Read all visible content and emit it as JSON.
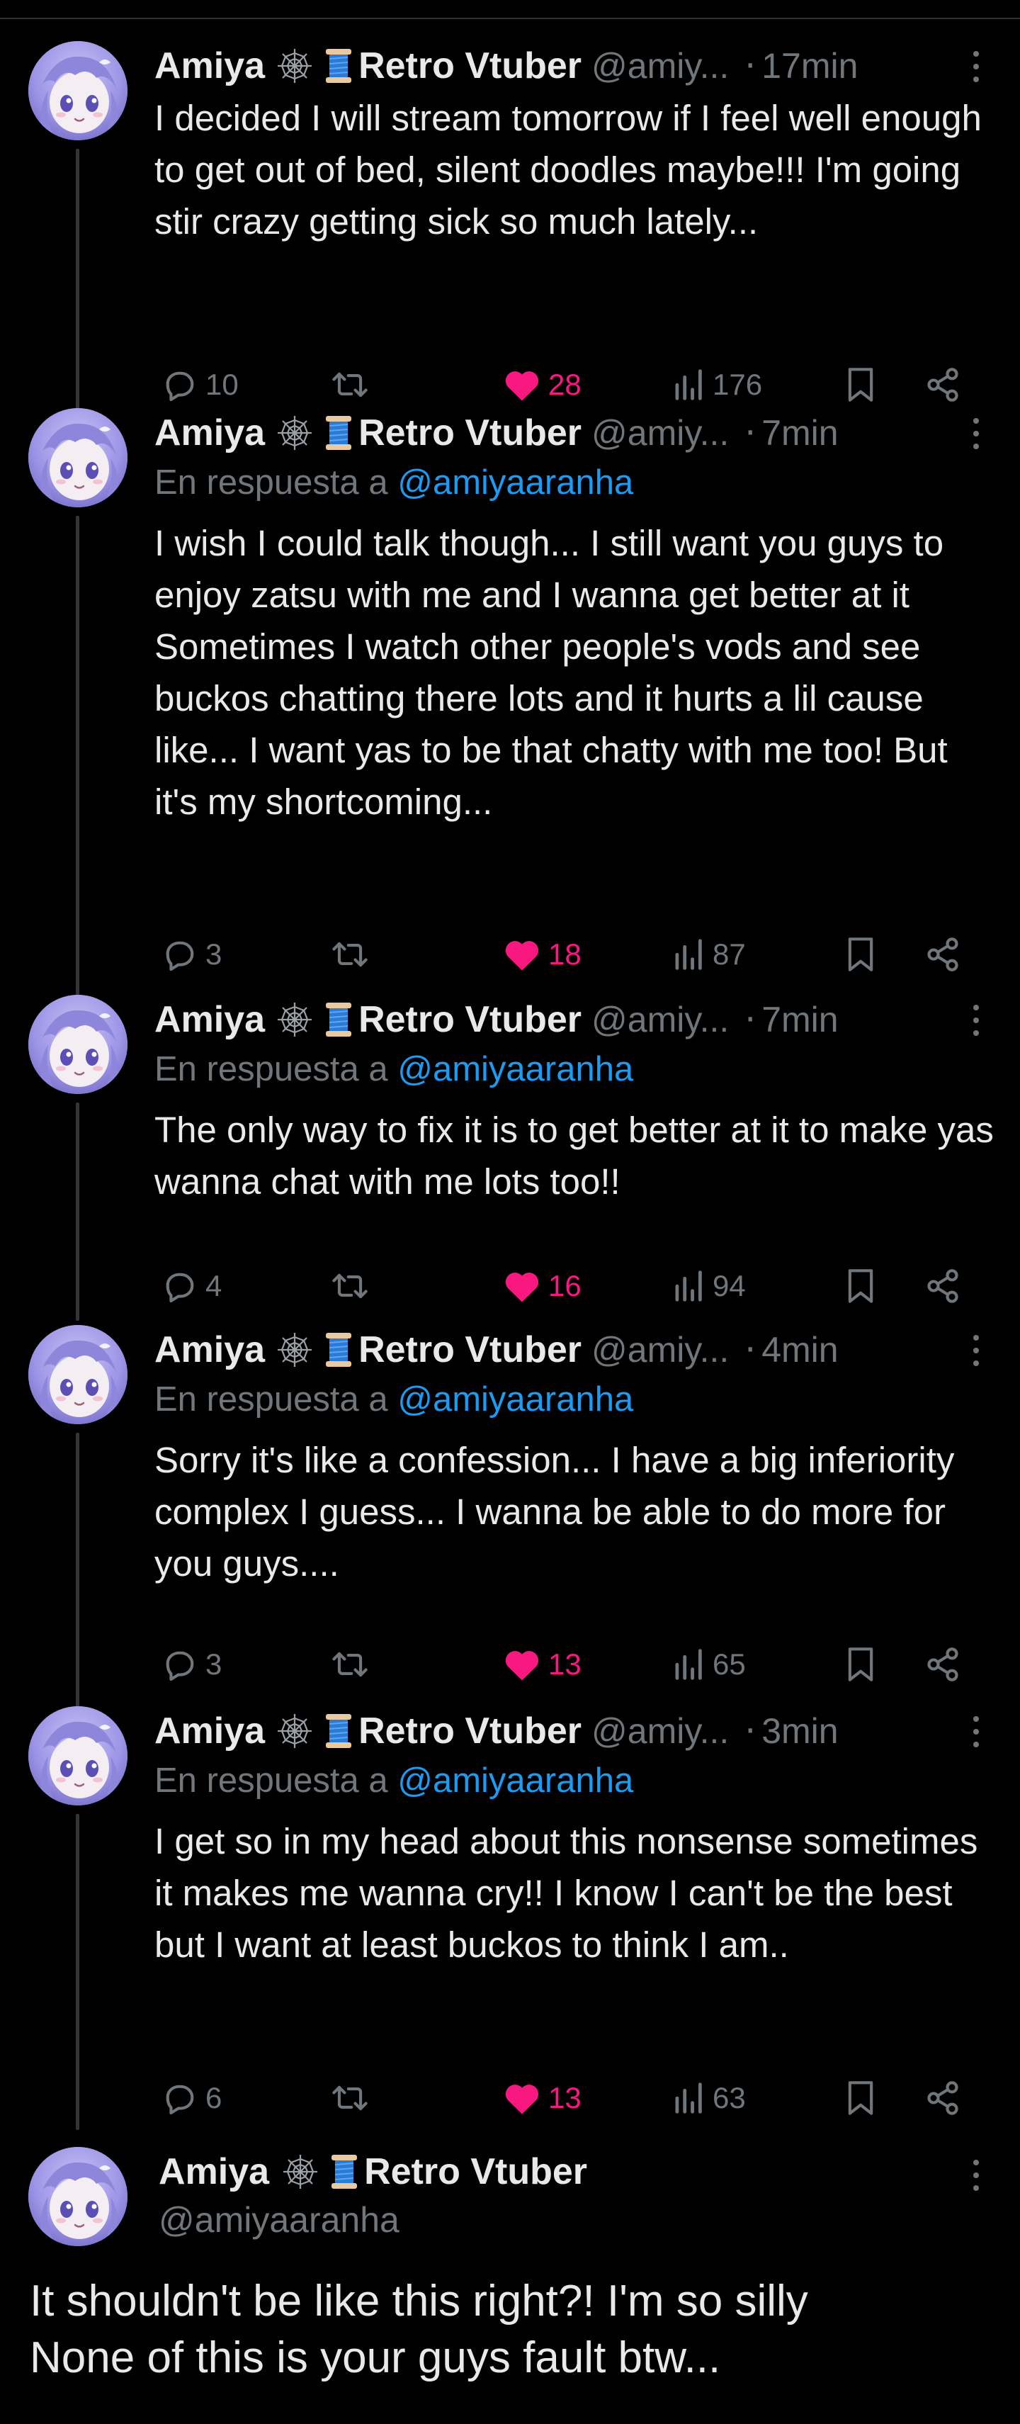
{
  "author": {
    "display_name": "Amiya",
    "badge_1": "spider-web-icon",
    "badge_2": "spool-of-thread-icon",
    "name_suffix": "Retro Vtuber",
    "handle_truncated": "@amiy...",
    "handle_full": "@amiyaaranha"
  },
  "reply_prefix": "En respuesta a",
  "reply_mention": "@amiyaaranha",
  "colors": {
    "background": "#000000",
    "text": "#e7e9ea",
    "muted": "#71767b",
    "mention": "#1d9bf0",
    "like": "#f91880",
    "thread_line": "#333639"
  },
  "posts": [
    {
      "time": "17min",
      "is_reply": false,
      "text": "I decided I will stream tomorrow if I feel well enough to get out of bed, silent doodles maybe!!! I'm going stir crazy getting sick so much lately...",
      "replies": "10",
      "likes": "28",
      "views": "176"
    },
    {
      "time": "7min",
      "is_reply": true,
      "text": "I wish I could talk though... I still want you guys to enjoy zatsu with me and I wanna get better at it\nSometimes I watch other people's vods and see buckos chatting there lots and it hurts a lil cause like... I want yas to be that chatty with me too! But it's my shortcoming...",
      "replies": "3",
      "likes": "18",
      "views": "87"
    },
    {
      "time": "7min",
      "is_reply": true,
      "text": "The only way to fix it is to get better at it to make yas wanna chat with me lots too!!",
      "replies": "4",
      "likes": "16",
      "views": "94"
    },
    {
      "time": "4min",
      "is_reply": true,
      "text": "Sorry it's like a confession... I have a big inferiority complex I guess... I wanna be able to do more for you guys....",
      "replies": "3",
      "likes": "13",
      "views": "65"
    },
    {
      "time": "3min",
      "is_reply": true,
      "text": "I get so in my head about this nonsense sometimes it makes me wanna cry!! I know I can't be the best but I want at least buckos to think I am..",
      "replies": "6",
      "likes": "13",
      "views": "63"
    }
  ],
  "focused_post": {
    "text": "It shouldn't be like this right?! I'm so silly\nNone of this is your guys fault btw..."
  }
}
